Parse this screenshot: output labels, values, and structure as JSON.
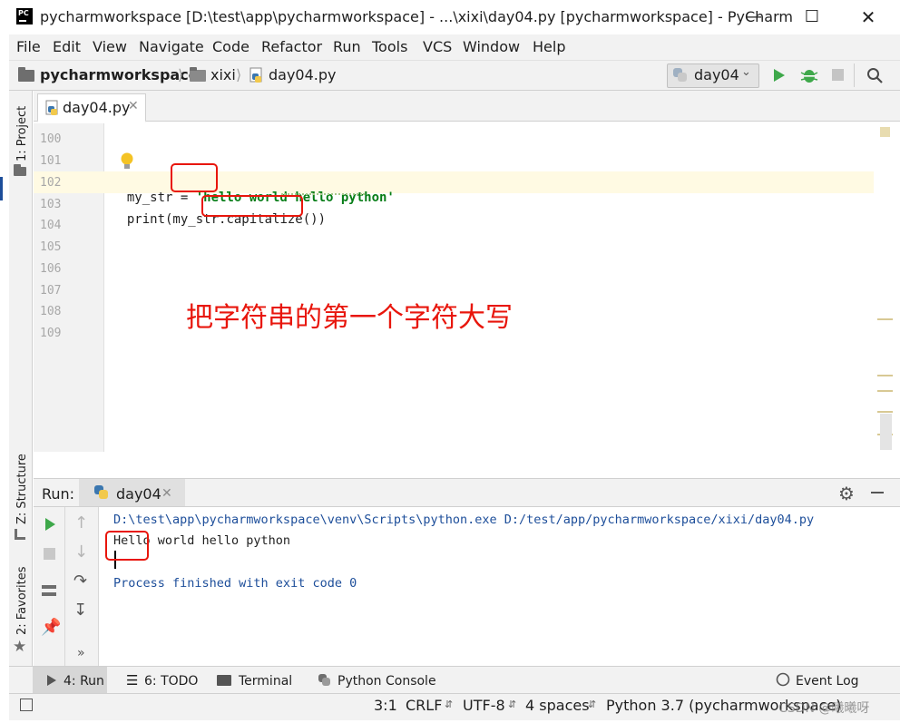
{
  "window": {
    "title": "pycharmworkspace [D:\\test\\app\\pycharmworkspace] - ...\\xixi\\day04.py [pycharmworkspace] - PyCharm",
    "logo_text": "PC"
  },
  "menu": [
    "File",
    "Edit",
    "View",
    "Navigate",
    "Code",
    "Refactor",
    "Run",
    "Tools",
    "VCS",
    "Window",
    "Help"
  ],
  "breadcrumb": [
    "pycharmworkspace",
    "xixi",
    "day04.py"
  ],
  "run_config": "day04",
  "left_tools": [
    "1: Project",
    "Z: Structure",
    "2: Favorites"
  ],
  "editor": {
    "tab": "day04.py",
    "line_numbers": [
      "100",
      "101",
      "102",
      "103",
      "104",
      "105",
      "106",
      "107",
      "108",
      "109"
    ],
    "code": {
      "line102_prefix": "my_str = ",
      "line102_string": "'hello world hello python'",
      "line103_prefix": "print(my_str.",
      "line103_call": "capitalize())"
    }
  },
  "annotation": "把字符串的第一个字符大写",
  "run_panel": {
    "label": "Run:",
    "tab": "day04",
    "console": {
      "command": "D:\\test\\app\\pycharmworkspace\\venv\\Scripts\\python.exe D:/test/app/pycharmworkspace/xixi/day04.py",
      "output": "Hello world hello python",
      "exit": "Process finished with exit code 0"
    }
  },
  "bottom_tools": [
    "4: Run",
    "6: TODO",
    "Terminal",
    "Python Console",
    "Event Log"
  ],
  "status_bar": {
    "position": "3:1",
    "line_sep": "CRLF",
    "encoding": "UTF-8",
    "indent": "4 spaces",
    "interpreter": "Python 3.7 (pycharmworkspace)",
    "watermark": "CSDN @曦曦呀"
  },
  "colors": {
    "accent_green": "#3ea84a",
    "highlight_red": "#e8160c",
    "string_green": "#067d17",
    "console_blue": "#1d4e9a",
    "caret_line": "#fffae3"
  }
}
